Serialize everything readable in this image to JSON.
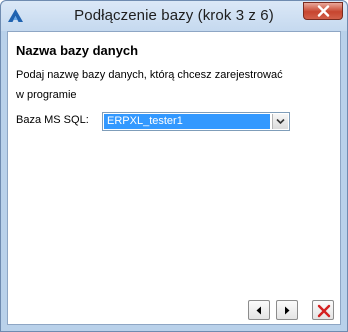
{
  "window": {
    "title": "Podłączenie bazy (krok 3 z 6)"
  },
  "content": {
    "heading": "Nazwa bazy danych",
    "description_line1": "Podaj nazwę bazy danych, którą chcesz zarejestrować",
    "description_line2": "w programie",
    "field_label": "Baza MS SQL:",
    "database_value": "ERPXL_tester1"
  },
  "icons": {
    "app": "app-logo-icon",
    "close": "close-icon",
    "dropdown": "chevron-down-icon",
    "prev": "arrow-left-icon",
    "next": "arrow-right-icon",
    "cancel": "cancel-x-icon"
  },
  "colors": {
    "selection": "#3399ff",
    "cancel_red": "#d42020",
    "close_red": "#c7452f"
  }
}
